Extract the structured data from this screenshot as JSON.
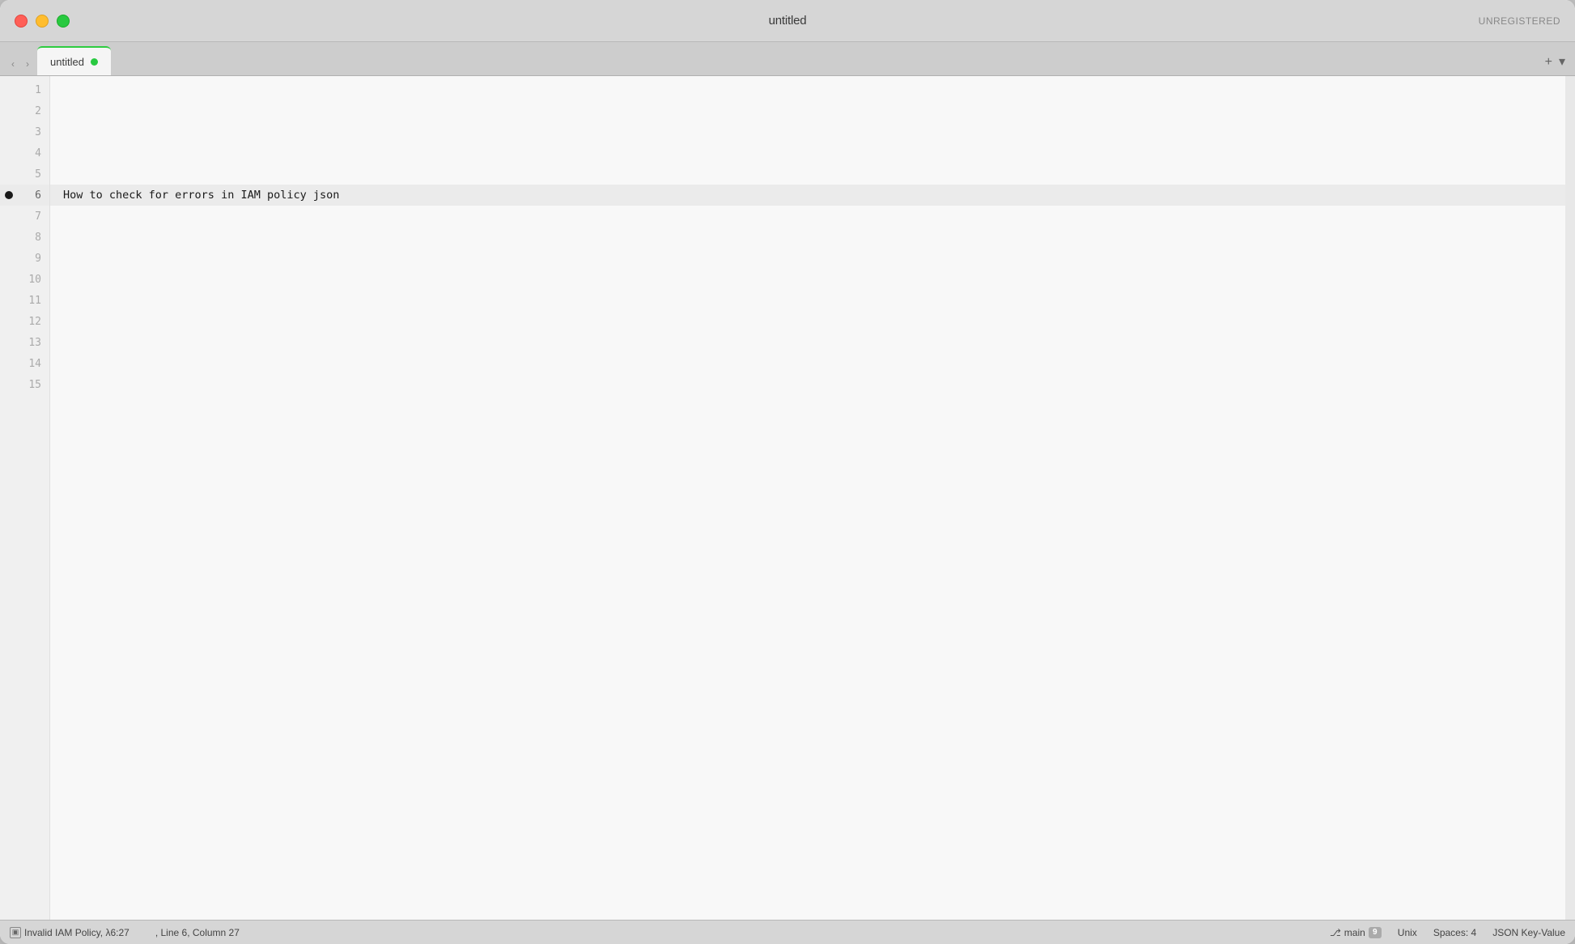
{
  "window": {
    "title": "untitled",
    "unregistered_label": "UNREGISTERED"
  },
  "traffic_lights": {
    "close_label": "close",
    "minimize_label": "minimize",
    "maximize_label": "maximize"
  },
  "tab_bar": {
    "tab_label": "untitled",
    "add_label": "+",
    "dropdown_label": "▾"
  },
  "editor": {
    "lines": [
      {
        "number": "1",
        "content": "",
        "active": false,
        "bookmark": false
      },
      {
        "number": "2",
        "content": "",
        "active": false,
        "bookmark": false
      },
      {
        "number": "3",
        "content": "",
        "active": false,
        "bookmark": false
      },
      {
        "number": "4",
        "content": "",
        "active": false,
        "bookmark": false
      },
      {
        "number": "5",
        "content": "",
        "active": false,
        "bookmark": false
      },
      {
        "number": "6",
        "content": "How to check for errors in IAM policy json",
        "active": true,
        "bookmark": true
      },
      {
        "number": "7",
        "content": "",
        "active": false,
        "bookmark": false
      },
      {
        "number": "8",
        "content": "",
        "active": false,
        "bookmark": false
      },
      {
        "number": "9",
        "content": "",
        "active": false,
        "bookmark": false
      },
      {
        "number": "10",
        "content": "",
        "active": false,
        "bookmark": false
      },
      {
        "number": "11",
        "content": "",
        "active": false,
        "bookmark": false
      },
      {
        "number": "12",
        "content": "",
        "active": false,
        "bookmark": false
      },
      {
        "number": "13",
        "content": "",
        "active": false,
        "bookmark": false
      },
      {
        "number": "14",
        "content": "",
        "active": false,
        "bookmark": false
      },
      {
        "number": "15",
        "content": "",
        "active": false,
        "bookmark": false
      }
    ]
  },
  "status_bar": {
    "error_label": "Invalid IAM Policy, λ6:27",
    "position_label": ", Line 6, Column 27",
    "branch_label": "main",
    "branch_count": "9",
    "line_endings": "Unix",
    "indentation": "Spaces: 4",
    "syntax": "JSON Key-Value"
  }
}
